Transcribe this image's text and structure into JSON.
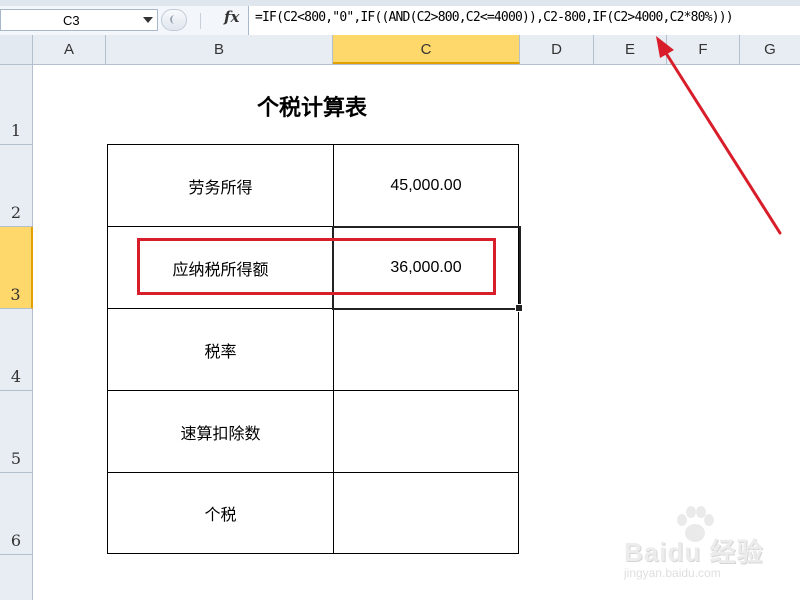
{
  "formula_bar": {
    "name_box": "C3",
    "fx_symbol": "fx",
    "formula": "=IF(C2<800,\"0\",IF((AND(C2>800,C2<=4000)),C2-800,IF(C2>4000,C2*80%)))"
  },
  "columns": [
    {
      "label": "A",
      "selected": false
    },
    {
      "label": "B",
      "selected": false
    },
    {
      "label": "C",
      "selected": true
    },
    {
      "label": "D",
      "selected": false
    },
    {
      "label": "E",
      "selected": false
    },
    {
      "label": "F",
      "selected": false
    },
    {
      "label": "G",
      "selected": false
    }
  ],
  "rows": [
    {
      "label": "1",
      "selected": false
    },
    {
      "label": "2",
      "selected": false
    },
    {
      "label": "3",
      "selected": true
    },
    {
      "label": "4",
      "selected": false
    },
    {
      "label": "5",
      "selected": false
    },
    {
      "label": "6",
      "selected": false
    }
  ],
  "sheet": {
    "title": "个税计算表",
    "active_cell": "C3",
    "table": [
      {
        "label": "劳务所得",
        "value": "45,000.00"
      },
      {
        "label": "应纳税所得额",
        "value": "36,000.00"
      },
      {
        "label": "税率",
        "value": ""
      },
      {
        "label": "速算扣除数",
        "value": ""
      },
      {
        "label": "个税",
        "value": ""
      }
    ]
  },
  "annotations": {
    "highlight_color": "#d81e2a",
    "arrow_color": "#d81e2a"
  },
  "watermark": {
    "logo_text": "Baidu 经验",
    "sub_text": "jingyan.baidu.com"
  },
  "colors": {
    "selected_header": "#ffd86b",
    "header_bg": "#e8edf3"
  }
}
